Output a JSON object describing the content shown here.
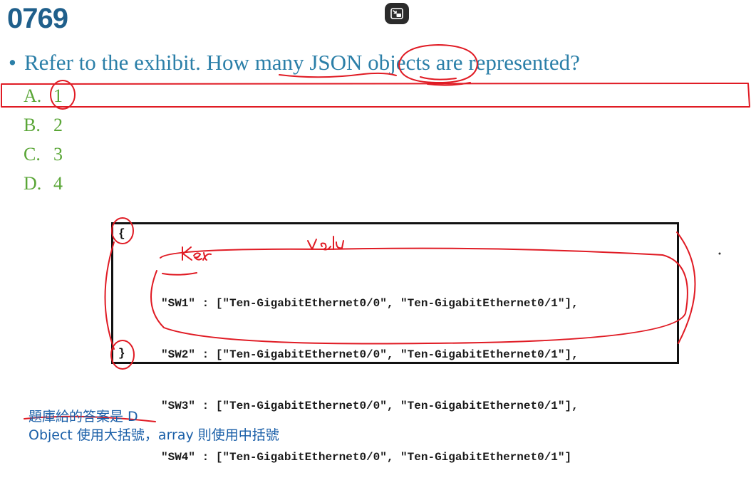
{
  "header": {
    "question_number": "0769"
  },
  "question": {
    "bullet": "•",
    "text": "Refer to the exhibit. How many JSON objects are represented?"
  },
  "options": [
    {
      "letter": "A.",
      "value": "1"
    },
    {
      "letter": "B.",
      "value": "2"
    },
    {
      "letter": "C.",
      "value": "3"
    },
    {
      "letter": "D.",
      "value": "4"
    }
  ],
  "exhibit": {
    "open_brace": "{",
    "close_brace": "}",
    "lines": [
      "\"SW1\" : [\"Ten-GigabitEthernet0/0\", \"Ten-GigabitEthernet0/1\"],",
      "\"SW2\" : [\"Ten-GigabitEthernet0/0\", \"Ten-GigabitEthernet0/1\"],",
      "\"SW3\" : [\"Ten-GigabitEthernet0/0\", \"Ten-GigabitEthernet0/1\"],",
      "\"SW4\" : [\"Ten-GigabitEthernet0/0\", \"Ten-GigabitEthernet0/1\"]"
    ]
  },
  "annotations": {
    "key_label": "Key",
    "value_label": "value",
    "highlight_color": "#e01b24"
  },
  "notes": {
    "line1": "題庫給的答案是 D",
    "line2": "Object 使用大括號，array 則使用中括號"
  }
}
